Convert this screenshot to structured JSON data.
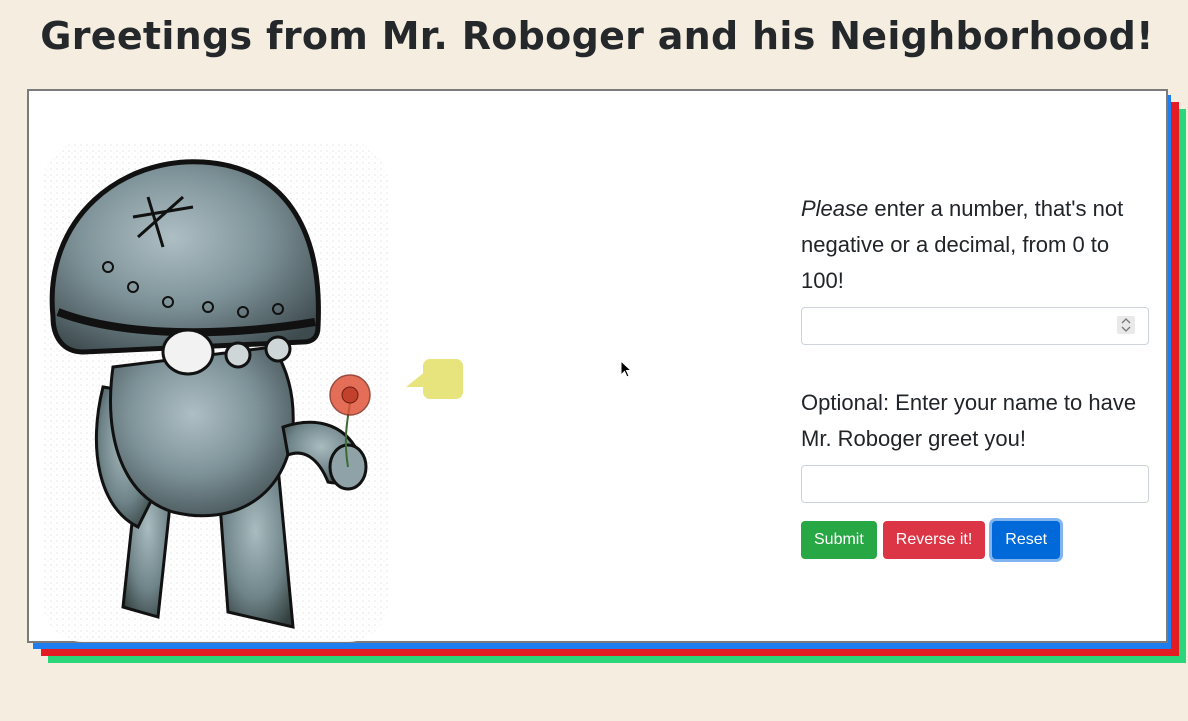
{
  "title": "Greetings from Mr. Roboger and his Neighborhood!",
  "form": {
    "number_prompt_em": "Please",
    "number_prompt_rest": " enter a number, that's not negative or a decimal, from 0 to 100!",
    "number_value": "",
    "name_prompt": "Optional: Enter your name to have Mr. Roboger greet you!",
    "name_value": ""
  },
  "buttons": {
    "submit": "Submit",
    "reverse": "Reverse it!",
    "reset": "Reset"
  },
  "colors": {
    "background": "#f5ede0",
    "submit": "#28a745",
    "reverse": "#dc3545",
    "reset": "#0069d9",
    "bubble": "#e7e37d",
    "shadow_blue": "#1e7ef0",
    "shadow_red": "#e31b23",
    "shadow_green": "#2bd67b"
  },
  "icons": {
    "robot": "robot-illustration",
    "bubble": "speech-bubble-icon",
    "cursor": "mouse-pointer-icon"
  }
}
